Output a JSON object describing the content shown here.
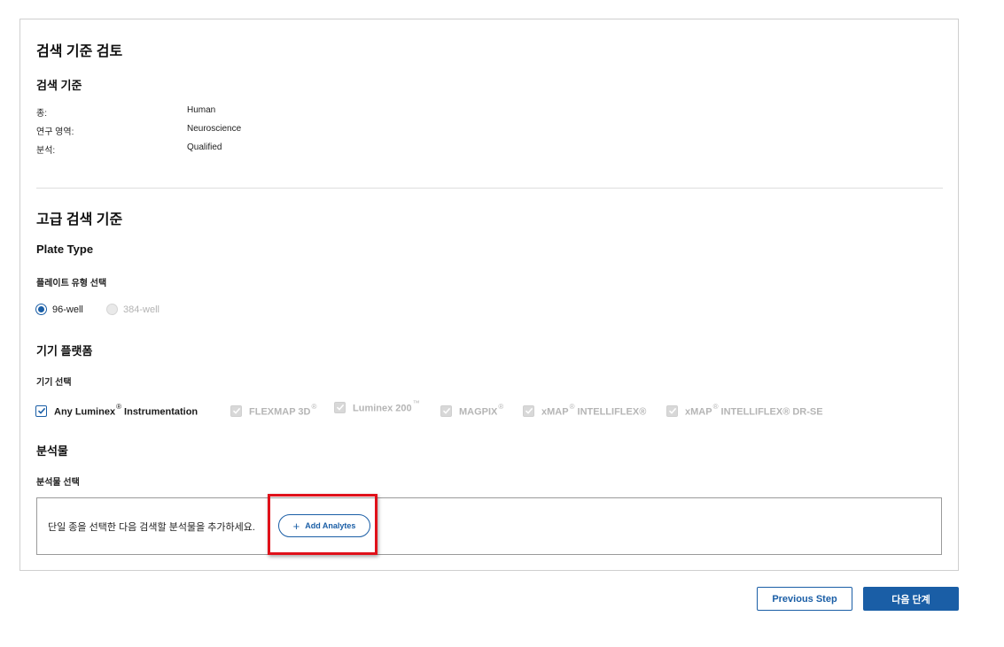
{
  "review": {
    "title": "검색 기준 검토",
    "criteria_heading": "검색 기준",
    "criteria": [
      {
        "label": "종:",
        "value": "Human"
      },
      {
        "label": "연구 영역:",
        "value": "Neuroscience"
      },
      {
        "label": "분석:",
        "value": "Qualified"
      }
    ]
  },
  "advanced": {
    "title": "고급 검색 기준",
    "plate_heading": "Plate Type",
    "plate_label": "플레이트 유형 선택",
    "plate_options": [
      {
        "label": "96-well",
        "selected": true,
        "disabled": false
      },
      {
        "label": "384-well",
        "selected": false,
        "disabled": true
      }
    ],
    "instrument_heading": "기기 플랫폼",
    "instrument_label": "기기 선택",
    "instruments": [
      {
        "label": "Any Luminex",
        "mark": "®",
        "suffix": " Instrumentation",
        "checked": true,
        "disabled": false
      },
      {
        "label": "FLEXMAP 3D",
        "mark": "®",
        "suffix": "",
        "checked": true,
        "disabled": true
      },
      {
        "label": "Luminex 200",
        "mark": "™",
        "suffix": "",
        "checked": true,
        "disabled": true
      },
      {
        "label": "MAGPIX",
        "mark": "®",
        "suffix": "",
        "checked": true,
        "disabled": true
      },
      {
        "label": "xMAP",
        "mark": "®",
        "suffix": " INTELLIFLEX®",
        "checked": true,
        "disabled": true
      },
      {
        "label": "xMAP",
        "mark": "®",
        "suffix": " INTELLIFLEX® DR-SE",
        "checked": true,
        "disabled": true
      }
    ],
    "analyte_heading": "분석물",
    "analyte_label": "분석물 선택",
    "analyte_hint": "단일 종을 선택한 다음 검색할 분석물을 추가하세요.",
    "add_analytes_label": "Add Analytes"
  },
  "footer": {
    "previous_label": "Previous Step",
    "next_label": "다음 단계"
  },
  "colors": {
    "accent": "#1a5ea6",
    "highlight": "#e0111a"
  }
}
